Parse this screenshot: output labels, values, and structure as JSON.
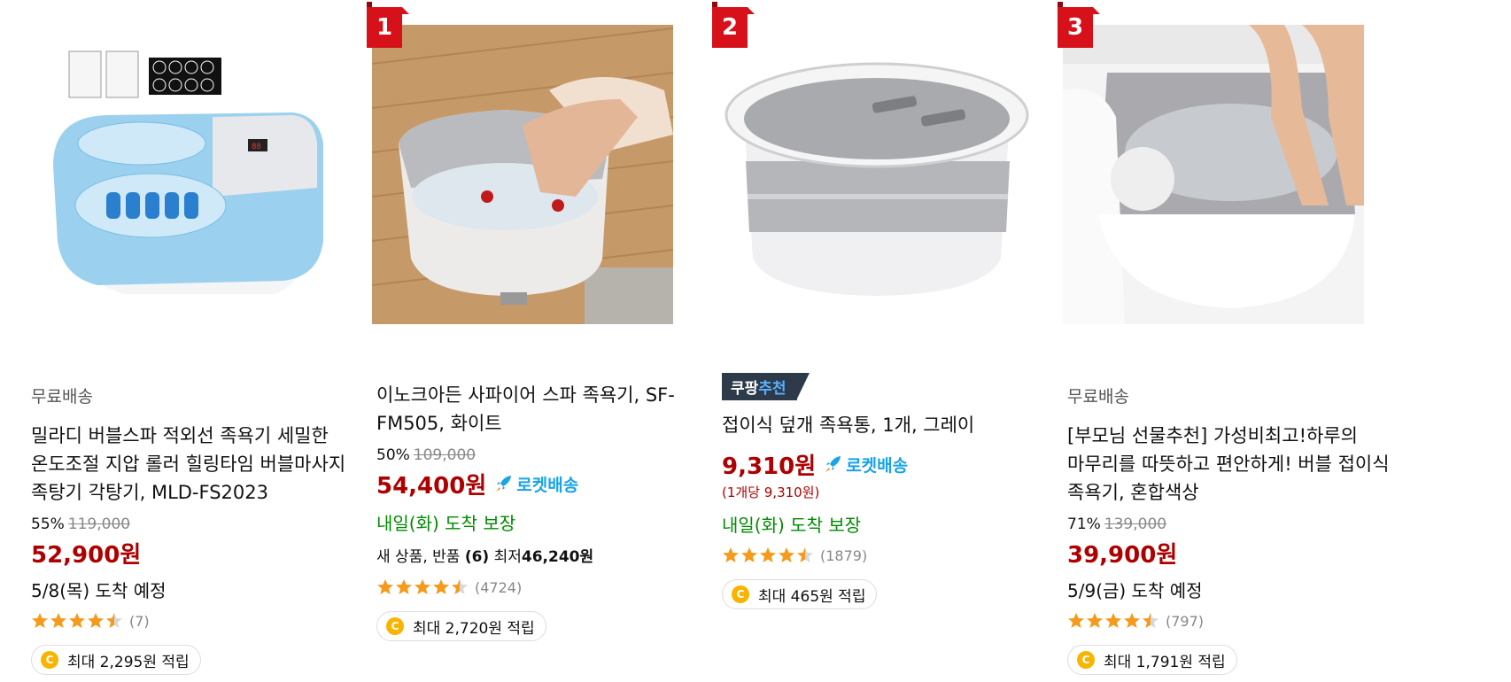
{
  "products": [
    {
      "rank": "",
      "free_shipping": "무료배송",
      "name": "밀라디 버블스파 적외선 족욕기 세밀한 온도조절 지압 롤러 힐링타임 버블마사지 족탕기 각탕기, MLD-FS2023",
      "discount": "55%",
      "original_price": "119,000",
      "price": "52,900원",
      "arrival": "5/8(목) 도착 예정",
      "rating": 4.5,
      "review_count": "(7)",
      "reward": "최대 2,295원 적립"
    },
    {
      "rank": "1",
      "name": "이노크아든 사파이어 스파 족욕기, SF-FM505, 화이트",
      "discount": "50%",
      "original_price": "109,000",
      "price": "54,400원",
      "rocket": "로켓배송",
      "arrival": "내일(화) 도착 보장",
      "offer_prefix": "새 상품, 반품",
      "offer_count": "(6)",
      "offer_lowest_label": "최저",
      "offer_lowest_price": "46,240원",
      "rating": 4.5,
      "review_count": "(4724)",
      "reward": "최대 2,720원 적립"
    },
    {
      "rank": "2",
      "badge_prefix": "쿠팡",
      "badge_suffix": "추천",
      "name": "접이식 덮개 족욕통, 1개, 그레이",
      "price": "9,310원",
      "rocket": "로켓배송",
      "unit_price": "(1개당 9,310원)",
      "arrival": "내일(화) 도착 보장",
      "rating": 4.5,
      "review_count": "(1879)",
      "reward": "최대 465원 적립"
    },
    {
      "rank": "3",
      "free_shipping": "무료배송",
      "name": "[부모님 선물추천] 가성비최고!하루의 마무리를 따뜻하고 편안하게! 버블 접이식 족욕기, 혼합색상",
      "discount": "71%",
      "original_price": "139,000",
      "price": "39,900원",
      "arrival": "5/9(금) 도착 예정",
      "rating": 4.5,
      "review_count": "(797)",
      "reward": "최대 1,791원 적립"
    }
  ],
  "coin_label": "C",
  "colors": {
    "price": "#ae0000",
    "rocket": "#1aa3e8",
    "rank": "#d6111a",
    "arrival_guarantee": "#008c00",
    "star": "#f59a1a"
  },
  "icons": {
    "rocket": "rocket-icon",
    "star": "star-icon",
    "coin": "coin-icon"
  }
}
